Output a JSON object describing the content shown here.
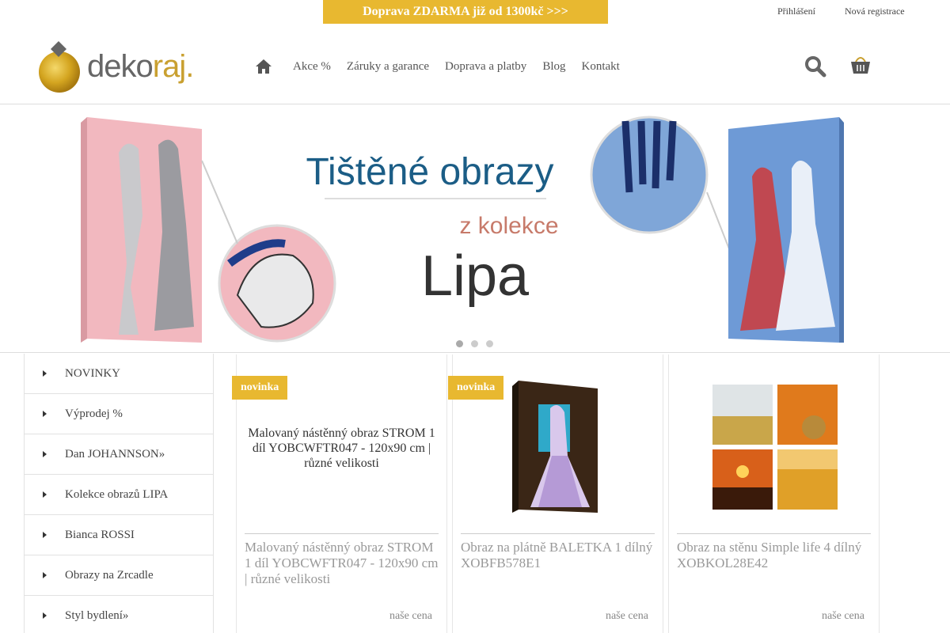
{
  "promo": {
    "text": "Doprava ZDARMA již od 1300kč >>>"
  },
  "account": {
    "login": "Přihlášení",
    "register": "Nová registrace"
  },
  "logo": {
    "prefix": "deko",
    "suffix": "raj.",
    "accent_color": "#c9a030"
  },
  "nav": {
    "items": [
      "Akce %",
      "Záruky a garance",
      "Doprava a platby",
      "Blog",
      "Kontakt"
    ]
  },
  "banner": {
    "title": "Tištěné obrazy",
    "subtitle": "z kolekce",
    "brand": "Lipa",
    "slides": 3,
    "active_slide": 1
  },
  "sidebar": {
    "items": [
      "NOVINKY",
      "Výprodej %",
      "Dan JOHANNSON»",
      "Kolekce obrazů LIPA",
      "Bianca ROSSI",
      "Obrazy na Zrcadle",
      "Styl bydlení»"
    ]
  },
  "products": [
    {
      "badge": "novinka",
      "image_alt": "Malovaný nástěnný obraz STROM 1 díl YOBCWFTR047 - 120x90 cm | různé velikosti",
      "title": "Malovaný nástěnný obraz STROM 1 díl YOBCWFTR047 - 120x90 cm | různé velikosti",
      "price_label": "naše cena",
      "price": ""
    },
    {
      "badge": "novinka",
      "title": "Obraz na plátně BALETKA 1 dílný XOBFB578E1",
      "price_label": "naše cena",
      "price": ""
    },
    {
      "badge": "",
      "title": "Obraz na stěnu Simple life 4 dílný XOBKOL28E42",
      "price_label": "naše cena",
      "price": ""
    }
  ],
  "colors": {
    "accent": "#e8b830",
    "border": "#e2e2e2"
  }
}
